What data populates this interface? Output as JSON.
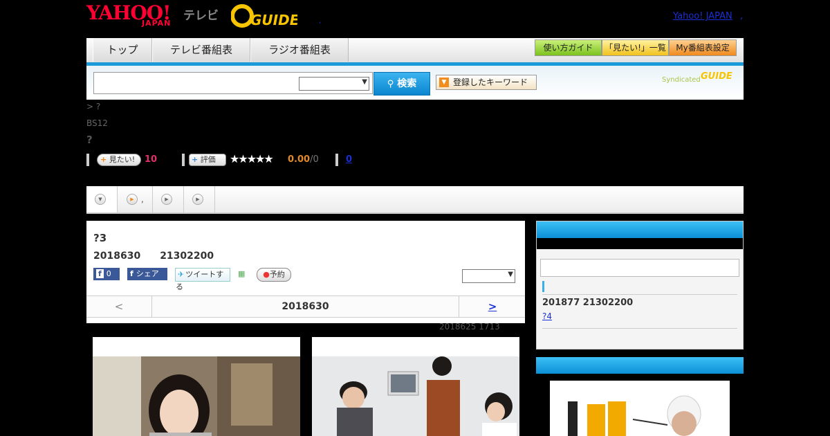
{
  "header": {
    "yahoo_logo": "YAHOO!",
    "japan_logo": "JAPAN",
    "tv_label": "テレビ",
    "gguide_logo": "GUIDE",
    "dot": ",",
    "top_link": "Yahoo! JAPAN",
    "top_link2": ","
  },
  "nav": {
    "tabs": [
      "トップ",
      "テレビ番組表",
      "ラジオ番組表"
    ],
    "util_buttons": [
      "使い方ガイド",
      "「見たい!」一覧",
      "My番組表設定"
    ]
  },
  "search": {
    "button": "検索",
    "keyword_button": "登録したキーワード",
    "syndicated": "Syndicated",
    "gguide": "GUIDE"
  },
  "program": {
    "breadcrumb": "> ?",
    "channel": "BS12",
    "title": "?",
    "mitai_label": "見たい!",
    "mitai_count": "10",
    "rate_label": "評価",
    "stars": "★★★★★",
    "rating": "0.00",
    "rating_total": "/0",
    "review_count": "0"
  },
  "tabs": {
    "second_tab_label": ","
  },
  "episode": {
    "title": "?3",
    "date": "2018630　　21302200",
    "fb_like": "0",
    "share": "シェア",
    "tweet": "ツイートする",
    "reserve": "予約",
    "pager_prev": "<",
    "pager_date": "2018630",
    "pager_next": ">",
    "updated": "2018625  1713"
  },
  "sidebar": {
    "next_date": "201877  21302200",
    "next_link": "?4"
  },
  "colors": {
    "accent_blue": "#1a9ad8",
    "link": "#1a2fd3",
    "pink": "#e0306a",
    "orange": "#e08a2a"
  }
}
